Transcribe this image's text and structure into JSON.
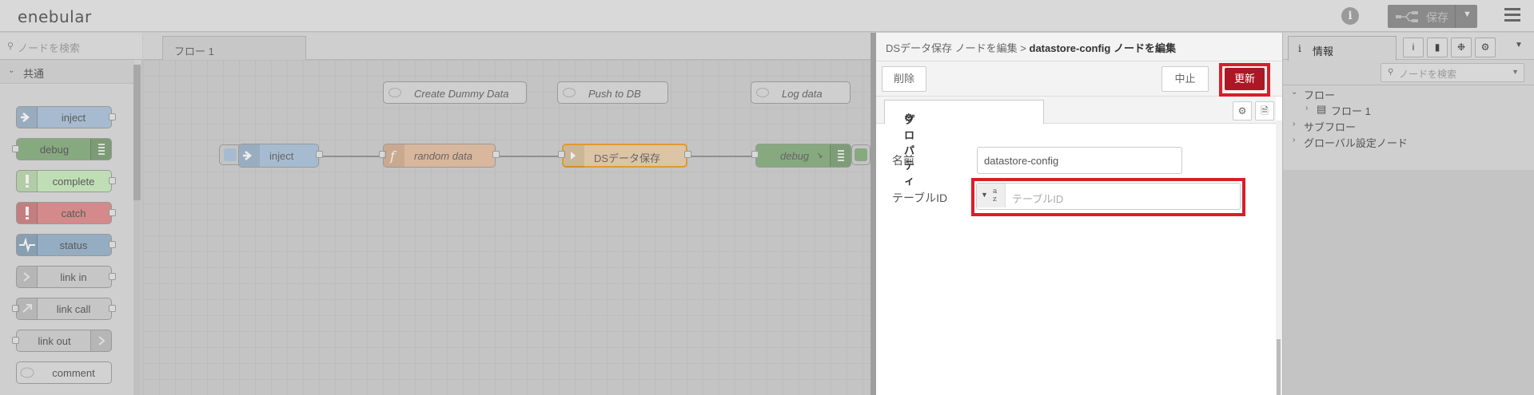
{
  "app": {
    "logo": "enebular"
  },
  "topbar": {
    "deploy_label": "保存",
    "help_icon": "info-icon",
    "menu_icon": "hamburger-icon"
  },
  "palette": {
    "search_placeholder": "ノードを検索",
    "category": "共通",
    "nodes": [
      "inject",
      "debug",
      "complete",
      "catch",
      "status",
      "link in",
      "link call",
      "link out",
      "comment"
    ]
  },
  "workspace": {
    "tab": "フロー 1",
    "comments": [
      "Create Dummy Data",
      "Push to DB",
      "Log data"
    ],
    "nodes": [
      "inject",
      "random data",
      "DSデータ保存",
      "debug"
    ]
  },
  "tray": {
    "breadcrumb_parent": "DSデータ保存 ノードを編集 >",
    "breadcrumb_current": "datastore-config ノードを編集",
    "delete_label": "削除",
    "cancel_label": "中止",
    "update_label": "更新",
    "tab_properties": "プロパティ",
    "name_label": "名前",
    "name_value": "datastore-config",
    "table_label": "テーブルID",
    "table_placeholder": "テーブルID",
    "highlight_color": "#d71f2a",
    "update_color": "#ad1625"
  },
  "sidebar": {
    "tab_label": "情報",
    "search_placeholder": "ノードを検索",
    "tree": {
      "flows": "フロー",
      "flow1": "フロー 1",
      "subflows": "サブフロー",
      "global": "グローバル設定ノード"
    }
  }
}
